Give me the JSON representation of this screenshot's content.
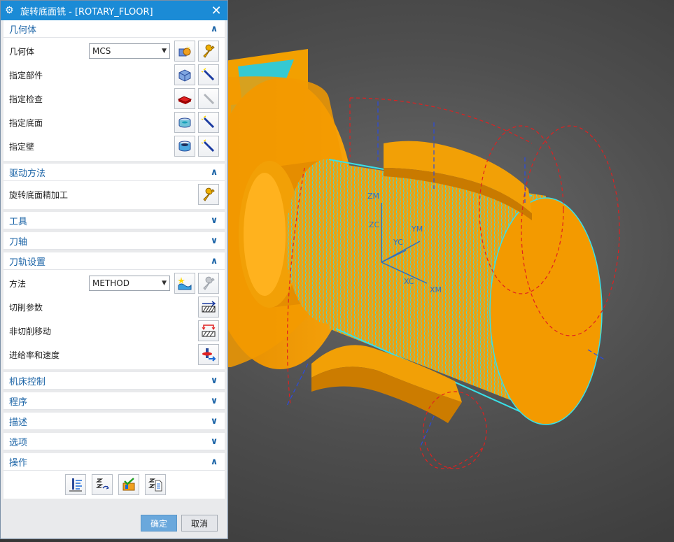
{
  "dialog": {
    "title": "旋转底面铣 - [ROTARY_FLOOR]",
    "title_icon": "gear-icon",
    "close_icon": "close-icon"
  },
  "sections": {
    "geometry": {
      "title": "几何体",
      "state": "expanded",
      "geometry_label": "几何体",
      "geometry_value": "MCS",
      "specify_part": "指定部件",
      "specify_check": "指定检查",
      "specify_floor": "指定底面",
      "specify_wall": "指定壁"
    },
    "drive": {
      "title": "驱动方法",
      "state": "expanded",
      "method_label": "旋转底面精加工"
    },
    "tool": {
      "title": "工具",
      "state": "collapsed"
    },
    "axis": {
      "title": "刀轴",
      "state": "collapsed"
    },
    "path": {
      "title": "刀轨设置",
      "state": "expanded",
      "method_label": "方法",
      "method_value": "METHOD",
      "cut_params": "切削参数",
      "non_cut_moves": "非切削移动",
      "feeds_speeds": "进给率和速度"
    },
    "machine": {
      "title": "机床控制",
      "state": "collapsed"
    },
    "program": {
      "title": "程序",
      "state": "collapsed"
    },
    "description": {
      "title": "描述",
      "state": "collapsed"
    },
    "options": {
      "title": "选项",
      "state": "collapsed"
    },
    "actions": {
      "title": "操作",
      "state": "expanded"
    }
  },
  "buttons": {
    "ok": "确定",
    "cancel": "取消"
  },
  "viewport": {
    "axis_labels": {
      "zm": "ZM",
      "zc": "ZC",
      "ym": "YM",
      "yc": "YC",
      "xc": "XC",
      "xm": "XM"
    }
  },
  "colors": {
    "titlebar": "#1b8bd6",
    "section_title": "#1a63a6",
    "part_orange": "#f39a00",
    "toolpath_cyan": "#39e0e8",
    "ok_button": "#6aa8dc"
  }
}
